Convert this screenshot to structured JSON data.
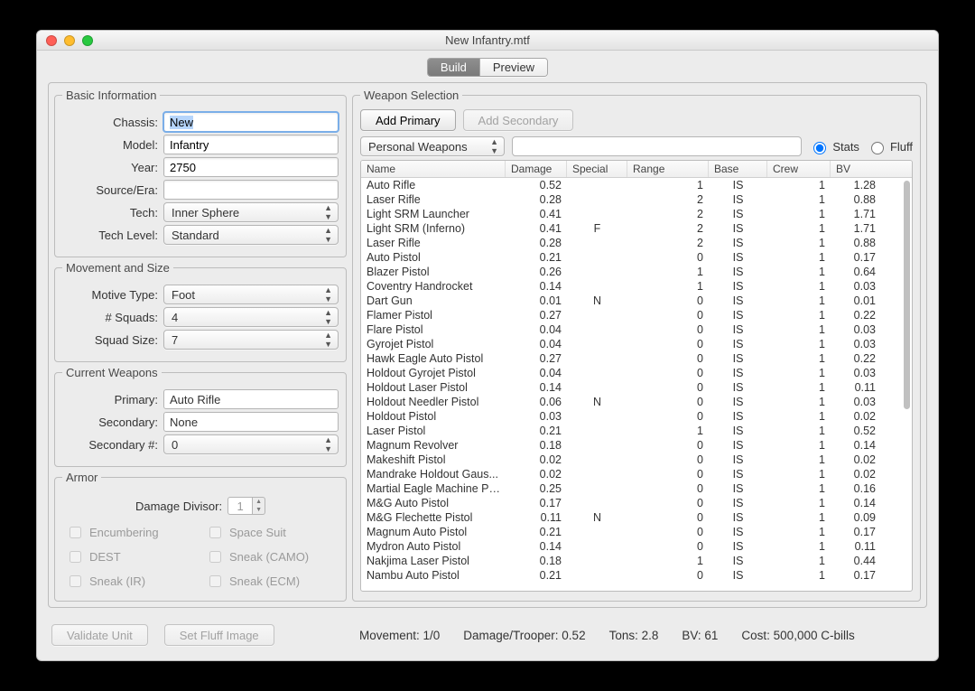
{
  "window_title": "New Infantry.mtf",
  "tabs": {
    "build": "Build",
    "preview": "Preview"
  },
  "basic_info": {
    "legend": "Basic Information",
    "chassis_label": "Chassis:",
    "chassis": "New",
    "model_label": "Model:",
    "model": "Infantry",
    "year_label": "Year:",
    "year": "2750",
    "source_label": "Source/Era:",
    "source": "",
    "tech_label": "Tech:",
    "tech": "Inner Sphere",
    "techlevel_label": "Tech Level:",
    "techlevel": "Standard"
  },
  "movement": {
    "legend": "Movement and Size",
    "motive_label": "Motive Type:",
    "motive": "Foot",
    "squads_label": "# Squads:",
    "squads": "4",
    "squadsize_label": "Squad Size:",
    "squadsize": "7"
  },
  "current_weapons": {
    "legend": "Current Weapons",
    "primary_label": "Primary:",
    "primary": "Auto Rifle",
    "secondary_label": "Secondary:",
    "secondary": "None",
    "secondary_n_label": "Secondary #:",
    "secondary_n": "0"
  },
  "armor": {
    "legend": "Armor",
    "divisor_label": "Damage Divisor:",
    "divisor": "1",
    "checks": {
      "encumbering": "Encumbering",
      "space_suit": "Space Suit",
      "dest": "DEST",
      "sneak_camo": "Sneak (CAMO)",
      "sneak_ir": "Sneak (IR)",
      "sneak_ecm": "Sneak (ECM)"
    }
  },
  "weapon_selection": {
    "legend": "Weapon Selection",
    "add_primary": "Add Primary",
    "add_secondary": "Add Secondary",
    "category": "Personal Weapons",
    "search": "",
    "radio_stats": "Stats",
    "radio_fluff": "Fluff",
    "columns": [
      "Name",
      "Damage",
      "Special",
      "Range",
      "Base",
      "Crew",
      "BV"
    ],
    "rows": [
      {
        "name": "Auto Rifle",
        "dmg": "0.52",
        "sp": "",
        "rng": "1",
        "base": "IS",
        "crew": "1",
        "bv": "1.28"
      },
      {
        "name": "Laser Rifle",
        "dmg": "0.28",
        "sp": "",
        "rng": "2",
        "base": "IS",
        "crew": "1",
        "bv": "0.88"
      },
      {
        "name": "Light SRM Launcher",
        "dmg": "0.41",
        "sp": "",
        "rng": "2",
        "base": "IS",
        "crew": "1",
        "bv": "1.71"
      },
      {
        "name": "Light SRM (Inferno)",
        "dmg": "0.41",
        "sp": "F",
        "rng": "2",
        "base": "IS",
        "crew": "1",
        "bv": "1.71"
      },
      {
        "name": "Laser Rifle",
        "dmg": "0.28",
        "sp": "",
        "rng": "2",
        "base": "IS",
        "crew": "1",
        "bv": "0.88"
      },
      {
        "name": "Auto Pistol",
        "dmg": "0.21",
        "sp": "",
        "rng": "0",
        "base": "IS",
        "crew": "1",
        "bv": "0.17"
      },
      {
        "name": "Blazer Pistol",
        "dmg": "0.26",
        "sp": "",
        "rng": "1",
        "base": "IS",
        "crew": "1",
        "bv": "0.64"
      },
      {
        "name": "Coventry Handrocket",
        "dmg": "0.14",
        "sp": "",
        "rng": "1",
        "base": "IS",
        "crew": "1",
        "bv": "0.03"
      },
      {
        "name": "Dart Gun",
        "dmg": "0.01",
        "sp": "N",
        "rng": "0",
        "base": "IS",
        "crew": "1",
        "bv": "0.01"
      },
      {
        "name": "Flamer Pistol",
        "dmg": "0.27",
        "sp": "",
        "rng": "0",
        "base": "IS",
        "crew": "1",
        "bv": "0.22"
      },
      {
        "name": "Flare Pistol",
        "dmg": "0.04",
        "sp": "",
        "rng": "0",
        "base": "IS",
        "crew": "1",
        "bv": "0.03"
      },
      {
        "name": "Gyrojet Pistol",
        "dmg": "0.04",
        "sp": "",
        "rng": "0",
        "base": "IS",
        "crew": "1",
        "bv": "0.03"
      },
      {
        "name": "Hawk Eagle Auto Pistol",
        "dmg": "0.27",
        "sp": "",
        "rng": "0",
        "base": "IS",
        "crew": "1",
        "bv": "0.22"
      },
      {
        "name": "Holdout Gyrojet Pistol",
        "dmg": "0.04",
        "sp": "",
        "rng": "0",
        "base": "IS",
        "crew": "1",
        "bv": "0.03"
      },
      {
        "name": "Holdout Laser Pistol",
        "dmg": "0.14",
        "sp": "",
        "rng": "0",
        "base": "IS",
        "crew": "1",
        "bv": "0.11"
      },
      {
        "name": "Holdout Needler Pistol",
        "dmg": "0.06",
        "sp": "N",
        "rng": "0",
        "base": "IS",
        "crew": "1",
        "bv": "0.03"
      },
      {
        "name": "Holdout Pistol",
        "dmg": "0.03",
        "sp": "",
        "rng": "0",
        "base": "IS",
        "crew": "1",
        "bv": "0.02"
      },
      {
        "name": "Laser Pistol",
        "dmg": "0.21",
        "sp": "",
        "rng": "1",
        "base": "IS",
        "crew": "1",
        "bv": "0.52"
      },
      {
        "name": "Magnum Revolver",
        "dmg": "0.18",
        "sp": "",
        "rng": "0",
        "base": "IS",
        "crew": "1",
        "bv": "0.14"
      },
      {
        "name": "Makeshift Pistol",
        "dmg": "0.02",
        "sp": "",
        "rng": "0",
        "base": "IS",
        "crew": "1",
        "bv": "0.02"
      },
      {
        "name": "Mandrake Holdout Gaus...",
        "dmg": "0.02",
        "sp": "",
        "rng": "0",
        "base": "IS",
        "crew": "1",
        "bv": "0.02"
      },
      {
        "name": "Martial Eagle Machine Pi...",
        "dmg": "0.25",
        "sp": "",
        "rng": "0",
        "base": "IS",
        "crew": "1",
        "bv": "0.16"
      },
      {
        "name": "M&G Auto Pistol",
        "dmg": "0.17",
        "sp": "",
        "rng": "0",
        "base": "IS",
        "crew": "1",
        "bv": "0.14"
      },
      {
        "name": "M&G Flechette Pistol",
        "dmg": "0.11",
        "sp": "N",
        "rng": "0",
        "base": "IS",
        "crew": "1",
        "bv": "0.09"
      },
      {
        "name": "Magnum Auto Pistol",
        "dmg": "0.21",
        "sp": "",
        "rng": "0",
        "base": "IS",
        "crew": "1",
        "bv": "0.17"
      },
      {
        "name": "Mydron Auto Pistol",
        "dmg": "0.14",
        "sp": "",
        "rng": "0",
        "base": "IS",
        "crew": "1",
        "bv": "0.11"
      },
      {
        "name": "Nakjima Laser Pistol",
        "dmg": "0.18",
        "sp": "",
        "rng": "1",
        "base": "IS",
        "crew": "1",
        "bv": "0.44"
      },
      {
        "name": "Nambu Auto Pistol",
        "dmg": "0.21",
        "sp": "",
        "rng": "0",
        "base": "IS",
        "crew": "1",
        "bv": "0.17"
      }
    ]
  },
  "footer": {
    "validate": "Validate Unit",
    "fluff": "Set Fluff Image",
    "movement": "Movement: 1/0",
    "dpt": "Damage/Trooper: 0.52",
    "tons": "Tons: 2.8",
    "bv": "BV: 61",
    "cost": "Cost: 500,000 C-bills"
  }
}
